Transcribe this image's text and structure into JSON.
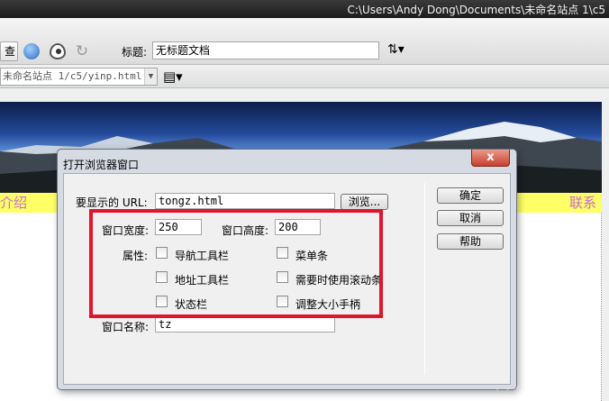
{
  "window": {
    "title": "C:\\Users\\Andy Dong\\Documents\\未命名站点 1\\c5"
  },
  "toolbar": {
    "view_button_label": "查",
    "title_label": "标题:",
    "title_value": "无标题文档"
  },
  "pathbar": {
    "path": "未命名站点 1/c5/yinp.html"
  },
  "page": {
    "nav_left": "介绍",
    "nav_right": "联系"
  },
  "dialog": {
    "title": "打开浏览器窗口",
    "close_glyph": "x",
    "url_label": "要显示的 URL:",
    "url_value": "tongz.html",
    "browse_label": "浏览...",
    "width_label": "窗口宽度:",
    "width_value": "250",
    "height_label": "窗口高度:",
    "height_value": "200",
    "attributes_label": "属性:",
    "checkboxes": [
      {
        "label": "导航工具栏",
        "checked": false
      },
      {
        "label": "菜单条",
        "checked": false
      },
      {
        "label": "地址工具栏",
        "checked": false
      },
      {
        "label": "需要时使用滚动条",
        "checked": false
      },
      {
        "label": "状态栏",
        "checked": false
      },
      {
        "label": "调整大小手柄",
        "checked": false
      }
    ],
    "name_label": "窗口名称:",
    "name_value": "tz",
    "ok_label": "确定",
    "cancel_label": "取消",
    "help_label": "帮助"
  },
  "annotation": {
    "highlight_color": "#e0142a"
  }
}
